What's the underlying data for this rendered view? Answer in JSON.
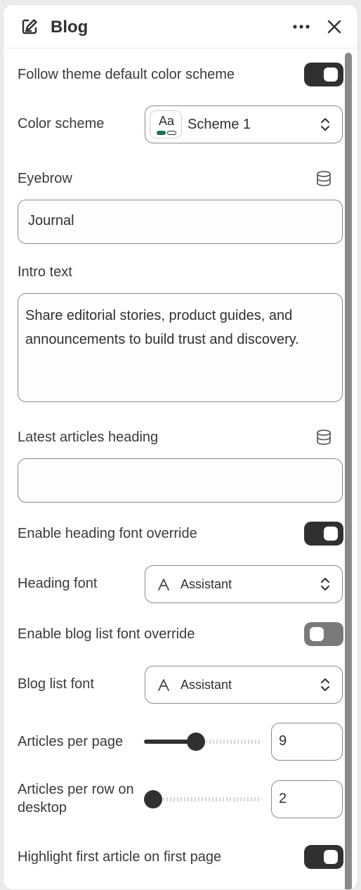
{
  "header": {
    "title": "Blog",
    "icons": {
      "title": "edit-page-icon",
      "more": "more-horizontal-icon",
      "close": "close-icon"
    }
  },
  "settings": {
    "follow_theme_scheme": {
      "label": "Follow theme default color scheme",
      "checked": true
    },
    "color_scheme": {
      "label": "Color scheme",
      "value": "Scheme 1",
      "swatch_text": "Aa",
      "swatch_accent": "#1f6f5c"
    },
    "eyebrow": {
      "label": "Eyebrow",
      "value": "Journal",
      "icon": "dynamic-source-icon"
    },
    "intro_text": {
      "label": "Intro text",
      "value": "Share editorial stories, product guides, and announcements to build trust and discovery."
    },
    "latest_heading": {
      "label": "Latest articles heading",
      "value": "",
      "icon": "dynamic-source-icon"
    },
    "heading_font_override": {
      "label": "Enable heading font override",
      "checked": true
    },
    "heading_font": {
      "label": "Heading font",
      "value": "Assistant",
      "icon": "font-icon"
    },
    "blog_list_font_override": {
      "label": "Enable blog list font override",
      "checked": false
    },
    "blog_list_font": {
      "label": "Blog list font",
      "value": "Assistant",
      "icon": "font-icon"
    },
    "articles_per_page": {
      "label": "Articles per page",
      "value": "9",
      "slider_fraction": 0.43
    },
    "articles_per_row": {
      "label": "Articles per row on desktop",
      "value": "2",
      "slider_fraction": 0.0
    },
    "highlight_first": {
      "label": "Highlight first article on first page",
      "checked": true
    }
  },
  "colors": {
    "toggle_on": "#303030",
    "toggle_off": "#7a7a7a",
    "border": "#8a8a8a",
    "text": "#303030"
  }
}
